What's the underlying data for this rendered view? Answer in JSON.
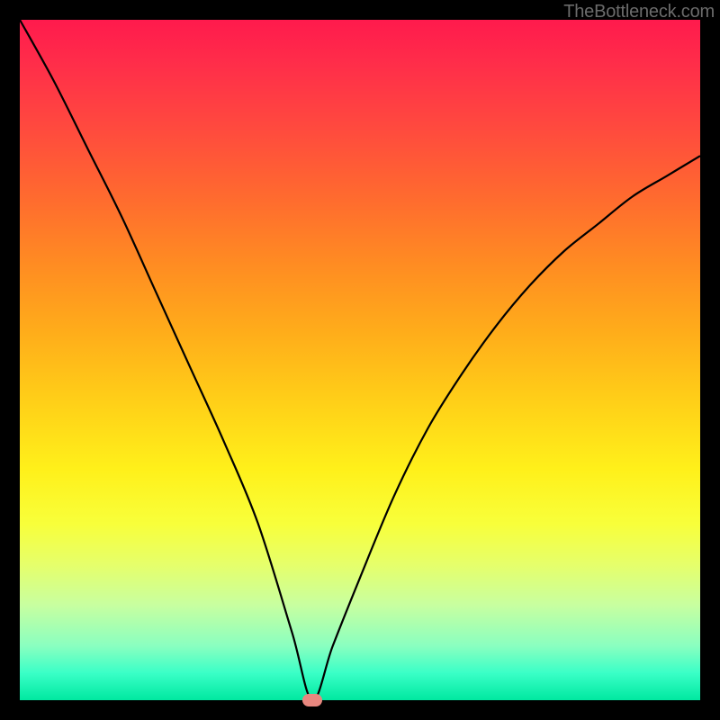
{
  "watermark": "TheBottleneck.com",
  "chart_data": {
    "type": "line",
    "title": "",
    "xlabel": "",
    "ylabel": "",
    "x_range": [
      0,
      100
    ],
    "y_range": [
      0,
      100
    ],
    "grid": false,
    "legend": false,
    "gradient_background": {
      "direction": "vertical",
      "stops": [
        {
          "pos": 0.0,
          "color": "#ff1a4d"
        },
        {
          "pos": 0.36,
          "color": "#ff8c22"
        },
        {
          "pos": 0.66,
          "color": "#fff01a"
        },
        {
          "pos": 1.0,
          "color": "#00e8a0"
        }
      ]
    },
    "series": [
      {
        "name": "bottleneck-curve",
        "note": "V-shaped curve; minimum touches x-axis around x≈43. Values are approximate (% of axis range) since no tick labels are shown.",
        "x": [
          0,
          5,
          10,
          15,
          20,
          25,
          30,
          35,
          40,
          43,
          46,
          50,
          55,
          60,
          65,
          70,
          75,
          80,
          85,
          90,
          95,
          100
        ],
        "values": [
          100,
          91,
          81,
          71,
          60,
          49,
          38,
          26,
          10,
          0,
          8,
          18,
          30,
          40,
          48,
          55,
          61,
          66,
          70,
          74,
          77,
          80
        ]
      }
    ],
    "marker": {
      "name": "optimum-point",
      "x": 43,
      "y": 0,
      "color": "#e8877f"
    }
  }
}
